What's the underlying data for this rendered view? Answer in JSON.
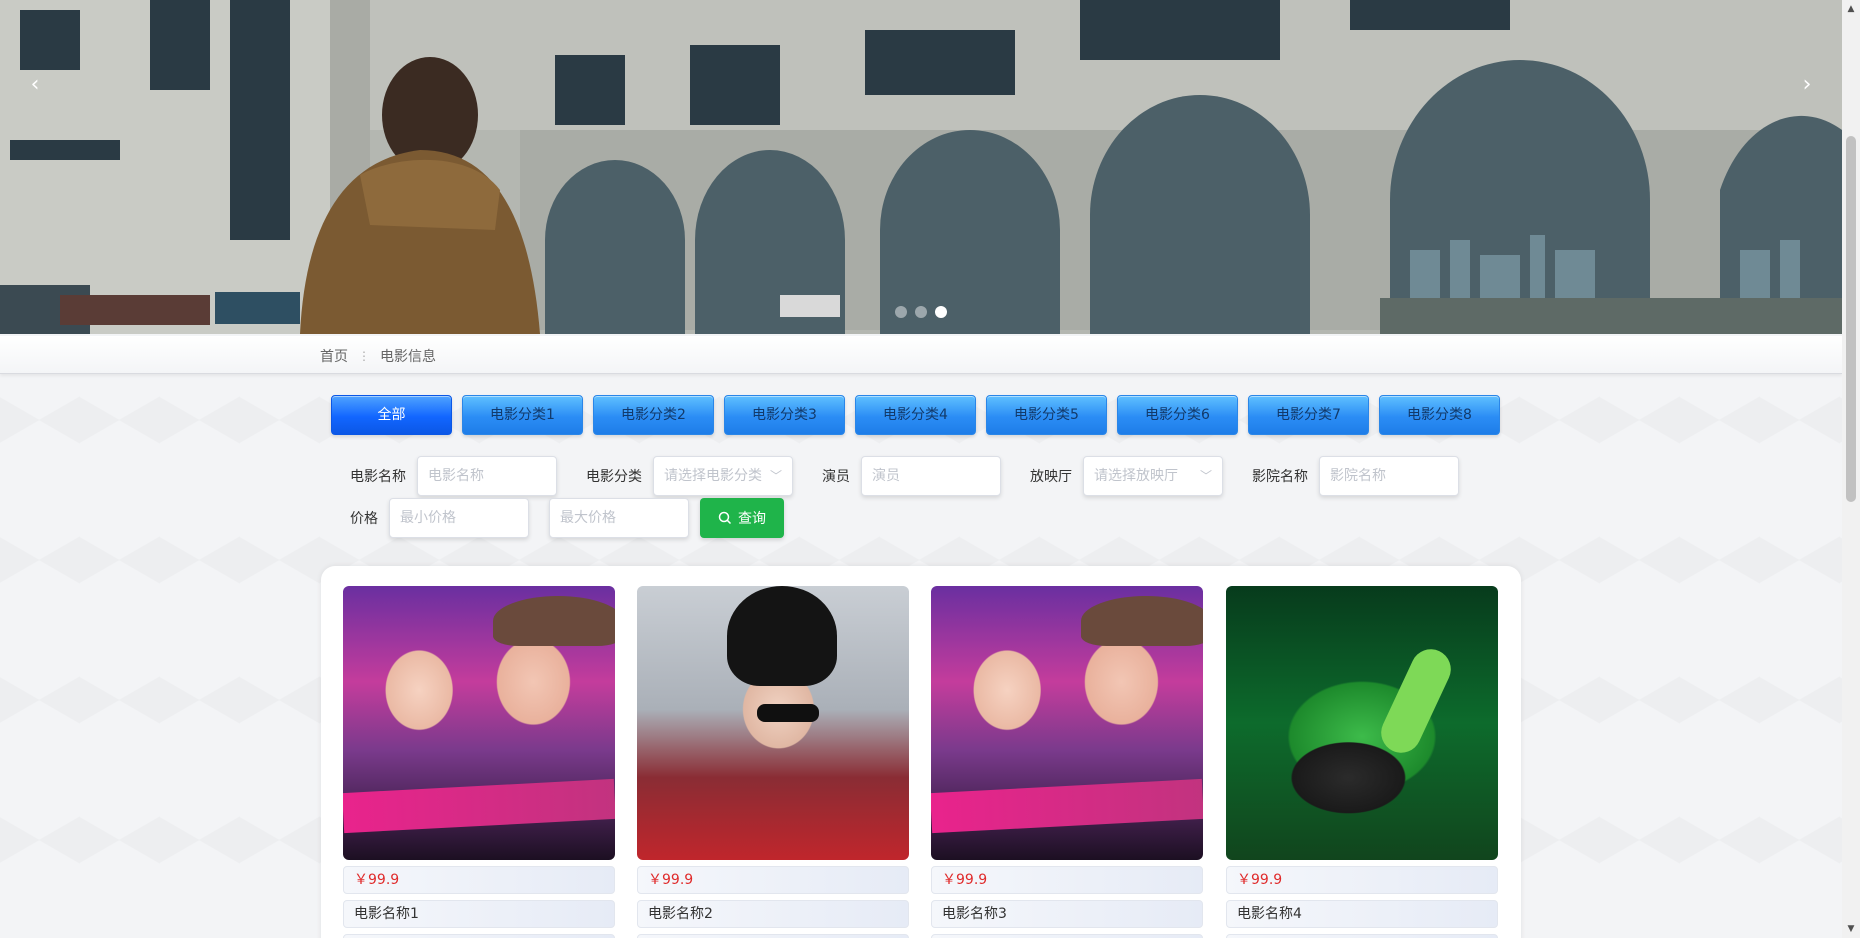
{
  "banner": {
    "prev_label": "‹",
    "next_label": "›",
    "slides": 3,
    "active_slide": 3
  },
  "breadcrumb": {
    "home": "首页",
    "separator": "⋮",
    "current": "电影信息"
  },
  "categories": [
    "全部",
    "电影分类1",
    "电影分类2",
    "电影分类3",
    "电影分类4",
    "电影分类5",
    "电影分类6",
    "电影分类7",
    "电影分类8"
  ],
  "search": {
    "name_label": "电影名称",
    "name_placeholder": "电影名称",
    "category_label": "电影分类",
    "category_placeholder": "请选择电影分类",
    "actor_label": "演员",
    "actor_placeholder": "演员",
    "hall_label": "放映厅",
    "hall_placeholder": "请选择放映厅",
    "cinema_label": "影院名称",
    "cinema_placeholder": "影院名称",
    "price_label": "价格",
    "min_price_placeholder": "最小价格",
    "max_price_placeholder": "最大价格",
    "submit_label": "查询"
  },
  "movies": [
    {
      "price": "￥99.9",
      "name": "电影名称1"
    },
    {
      "price": "￥99.9",
      "name": "电影名称2"
    },
    {
      "price": "￥99.9",
      "name": "电影名称3"
    },
    {
      "price": "￥99.9",
      "name": "电影名称4"
    }
  ],
  "colors": {
    "primary_blue": "#1266ff",
    "category_blue": "#2b8df5",
    "search_green": "#1fb44a",
    "price_red": "#e02b2b"
  }
}
